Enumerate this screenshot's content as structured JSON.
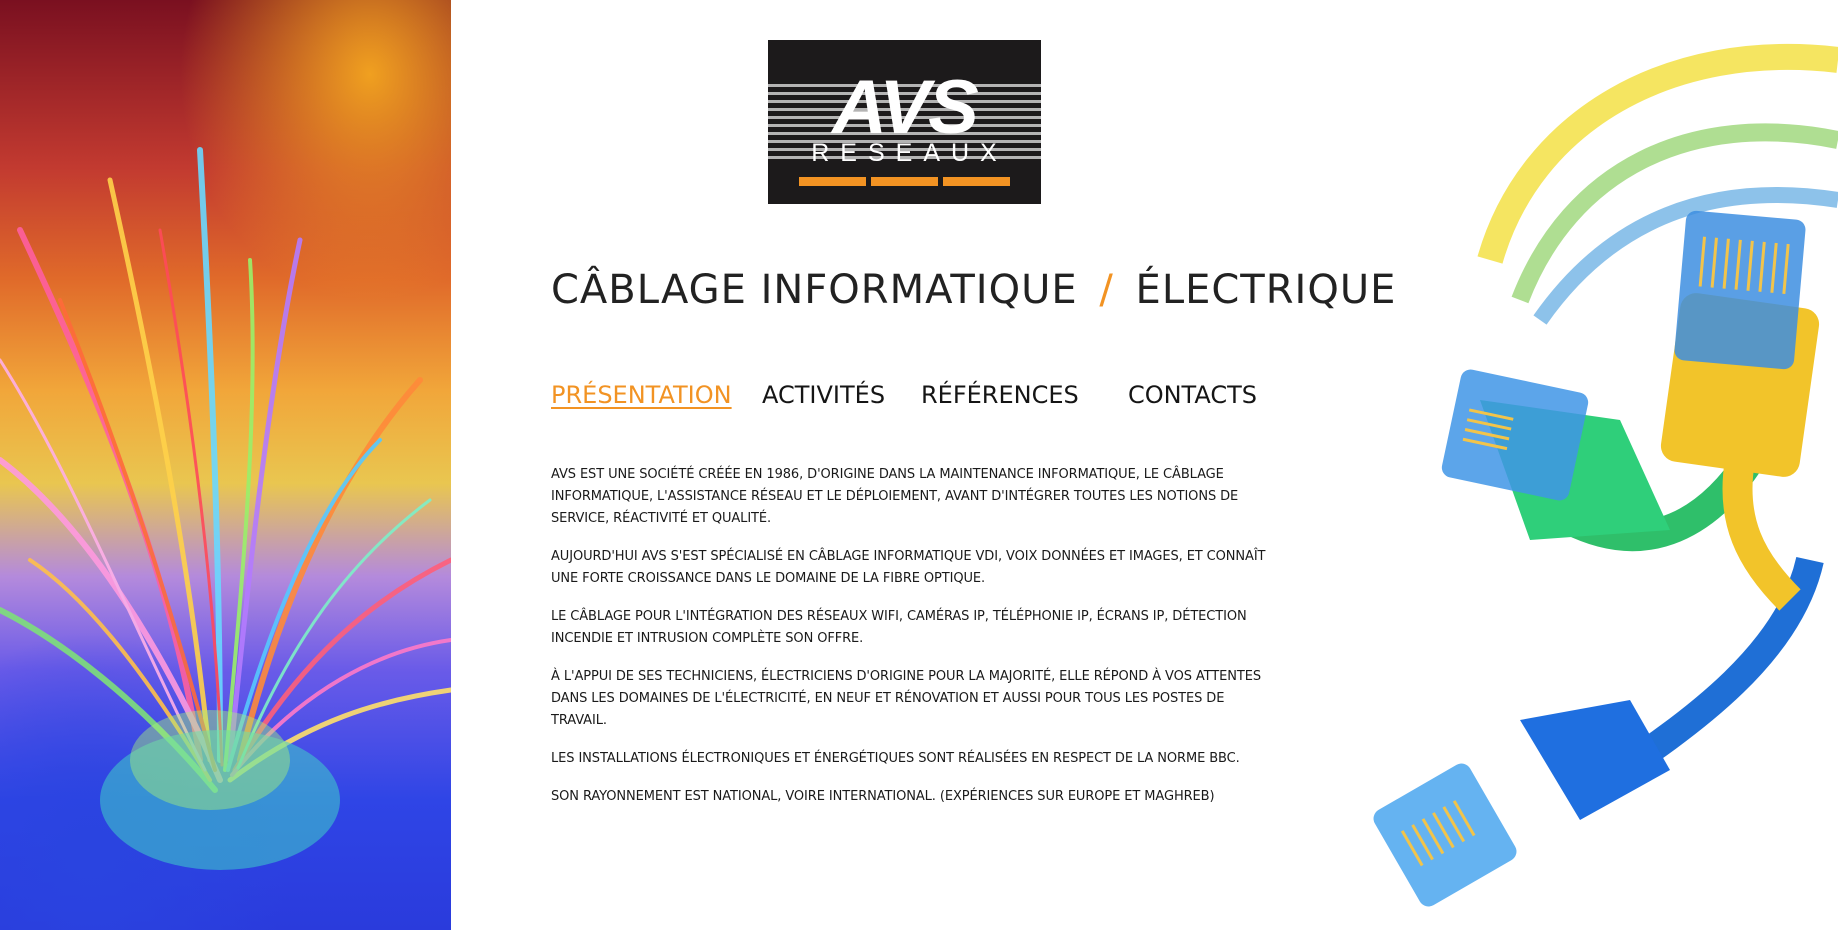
{
  "logo": {
    "mark": "AVS",
    "sub": "RESEAUX",
    "accent_color": "#f29323",
    "background_color": "#1c1a1b"
  },
  "tagline": {
    "part1": "CÂBLAGE INFORMATIQUE",
    "separator": "/",
    "part2": "ÉLECTRIQUE"
  },
  "nav": {
    "items": [
      {
        "label": "PRÉSENTATION",
        "active": true
      },
      {
        "label": "ACTIVITÉS",
        "active": false
      },
      {
        "label": "RÉFÉRENCES",
        "active": false
      },
      {
        "label": "CONTACTS",
        "active": false
      }
    ]
  },
  "content": {
    "paragraphs": [
      "AVS EST UNE SOCIÉTÉ CRÉÉE EN 1986, D'ORIGINE DANS LA MAINTENANCE INFORMATIQUE, LE CÂBLAGE INFORMATIQUE, L'ASSISTANCE RÉSEAU ET LE DÉPLOIEMENT, AVANT D'INTÉGRER TOUTES LES NOTIONS DE SERVICE, RÉACTIVITÉ ET QUALITÉ.",
      "AUJOURD'HUI AVS S'EST SPÉCIALISÉ EN CÂBLAGE INFORMATIQUE VDI, VOIX DONNÉES ET IMAGES, ET CONNAÎT UNE FORTE CROISSANCE DANS LE DOMAINE DE LA FIBRE OPTIQUE.",
      "LE CÂBLAGE POUR L'INTÉGRATION DES RÉSEAUX WIFI, CAMÉRAS IP, TÉLÉPHONIE IP, ÉCRANS IP, DÉTECTION INCENDIE ET INTRUSION COMPLÈTE SON OFFRE.",
      "À L'APPUI DE SES TECHNICIENS, ÉLECTRICIENS D'ORIGINE POUR LA MAJORITÉ, ELLE RÉPOND À VOS ATTENTES DANS LES DOMAINES DE L'ÉLECTRICITÉ, EN NEUF ET RÉNOVATION ET AUSSI POUR TOUS LES POSTES DE TRAVAIL.",
      "LES INSTALLATIONS ÉLECTRONIQUES ET ÉNERGÉTIQUES SONT RÉALISÉES EN RESPECT DE LA NORME BBC.",
      "SON RAYONNEMENT EST NATIONAL, VOIRE INTERNATIONAL. (EXPÉRIENCES SUR EUROPE ET MAGHREB)"
    ]
  },
  "images": {
    "left": "fiber-optic-strands-photo",
    "right": "ethernet-rj45-cables-photo"
  }
}
